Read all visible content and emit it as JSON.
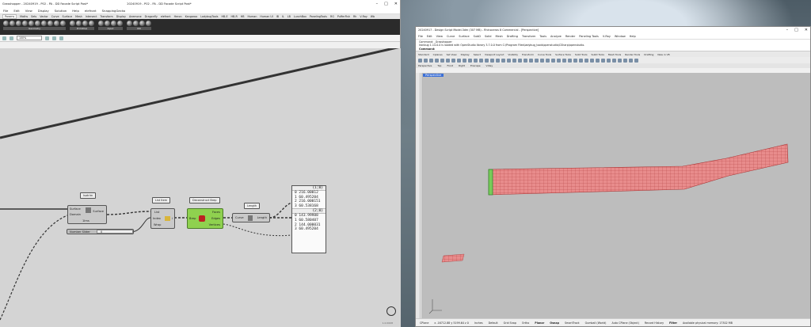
{
  "grasshopper": {
    "title_app": "Grasshopper - 20240919 - P02 - PA - DD Facade Script Post*",
    "title_doc": "20240919 - P02 - PA - DD Facade Script Post*",
    "menu": [
      "File",
      "Edit",
      "View",
      "Display",
      "Solution",
      "Help",
      "elefront",
      "SnappingGecko"
    ],
    "tabs": [
      "Params",
      "Maths",
      "Sets",
      "Vector",
      "Curve",
      "Surface",
      "Mesh",
      "Intersect",
      "Transform",
      "Display",
      "Anemone",
      "Dragonfly",
      "elefront",
      "Heron",
      "Kangaroo",
      "LadybugTools",
      "HB-E",
      "HB-R",
      "HB",
      "Human",
      "Human UI",
      "IB",
      "IL",
      "LB",
      "LunchBox",
      "PanelingTools",
      "RG",
      "PufferFish",
      "Rh",
      "V-Ray",
      "Wb"
    ],
    "active_tab": "Params",
    "toolbar_groups": [
      "Geometry",
      "Primitive",
      "Input",
      "Util"
    ],
    "zoom": "100%",
    "components": {
      "isotrim_title": "Isotrim",
      "isotrim_in1": "Surface",
      "isotrim_in2": "Domain",
      "isotrim_out": "Surface",
      "isotrim_footer": "1Ims",
      "slider_label": "Number Slider",
      "slider_value": "0",
      "listitem_title": "List Item",
      "listitem_in1": "List",
      "listitem_in2": "Index",
      "listitem_in3": "Wrap",
      "listitem_out": "i",
      "decon_title": "Deconstruct Brep",
      "decon_in": "Brep",
      "decon_out1": "Faces",
      "decon_out2": "Edges",
      "decon_out3": "Vertices",
      "length_title": "Length",
      "length_in": "Curve",
      "length_out": "Length"
    },
    "panel": {
      "branch1": "{1;0}",
      "rows1": [
        "0  216.00012",
        "1  60.495204",
        "2  216.000151",
        "3  60.538168"
      ],
      "branch2": "{2;0}",
      "rows2": [
        "0  143.99988",
        "1  60.580407",
        "2  144.000031",
        "3  60.495204"
      ]
    },
    "status": "1.0.0008"
  },
  "rhino": {
    "title": "20240917 - Design Script Model.3dm (307 MB) - Rhinoceros 8 Commercial - [Perspective]",
    "menu": [
      "File",
      "Edit",
      "View",
      "Curve",
      "Surface",
      "SubD",
      "Solid",
      "Mesh",
      "Drafting",
      "Transform",
      "Tools",
      "Analyze",
      "Render",
      "Paneling Tools",
      "V-Ray",
      "Window",
      "Help"
    ],
    "command_history": [
      "Command: _Grasshopper",
      "Ironbug 1.14.0.0 is loaded with OpenStudio library 3.7.0.0 from C:\\Program Files\\ladybug_tools\\openstudio\\CSharp\\openstudio."
    ],
    "command_prompt": "Command:",
    "tabs": [
      "Standard",
      "Cplanes",
      "Set View",
      "Display",
      "Select",
      "Viewport Layout",
      "Visibility",
      "Transform",
      "Curve Tools",
      "Surface Tools",
      "Solid Tools",
      "SubD Tools",
      "Mesh Tools",
      "Render Tools",
      "Drafting",
      "New in V8"
    ],
    "viewport_tabs": [
      "Perspective",
      "Top",
      "Front",
      "Right",
      "Enscape",
      "V-Ray"
    ],
    "viewport_label": "Perspective",
    "status": {
      "cplane": "CPlane",
      "coords": "x -16712.88  y 5199.64  z 0",
      "units": "Inches",
      "layer": "Default",
      "snaps": [
        "Grid Snap",
        "Ortho",
        "Planar",
        "Osnap",
        "SmartTrack",
        "Gumball (World)",
        "Auto CPlane (Object)",
        "Record History",
        "Filter"
      ],
      "memory": "Available physical memory: 17302 MB"
    }
  }
}
